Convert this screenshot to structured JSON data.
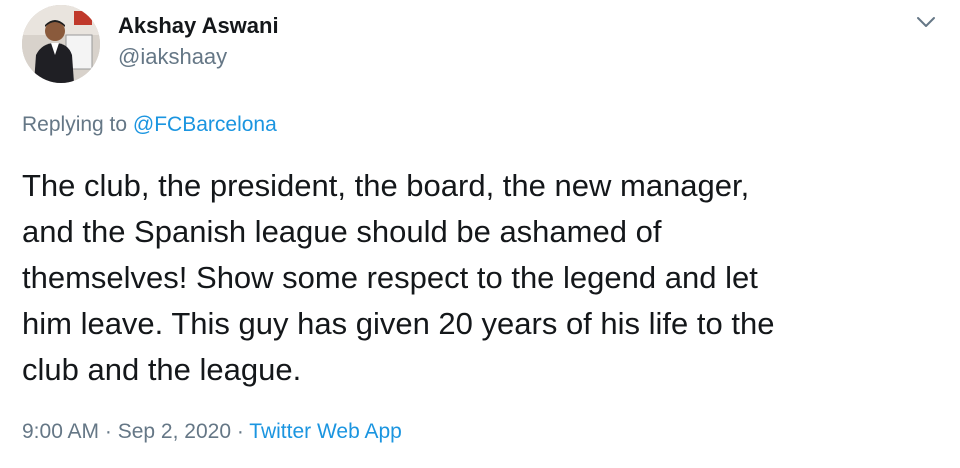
{
  "author": {
    "name": "Akshay Aswani",
    "handle": "@iakshaay"
  },
  "reply": {
    "prefix": "Replying to ",
    "mention": "@FCBarcelona"
  },
  "tweet": {
    "lines": [
      "The club, the president, the board, the new manager,",
      "and the Spanish league should be ashamed of",
      "themselves! Show some respect to the legend and let",
      "him leave. This guy has given 20 years of his life to the",
      "club and the league."
    ]
  },
  "meta": {
    "time": "9:00 AM",
    "separator": " · ",
    "date": "Sep 2, 2020",
    "source": "Twitter Web App"
  },
  "colors": {
    "text": "#14171a",
    "secondary": "#657786",
    "link": "#1b95e0",
    "background": "#ffffff"
  },
  "icons": {
    "avatar": "profile-photo",
    "menu": "chevron-down-icon"
  }
}
